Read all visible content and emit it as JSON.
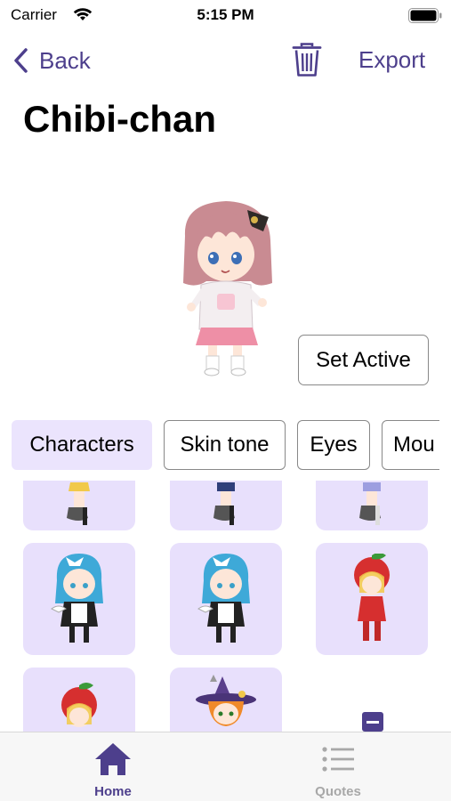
{
  "status_bar": {
    "carrier": "Carrier",
    "time": "5:15 PM"
  },
  "nav": {
    "back_label": "Back",
    "export_label": "Export"
  },
  "page": {
    "title": "Chibi-chan"
  },
  "actions": {
    "set_active_label": "Set Active"
  },
  "categories": {
    "items": [
      {
        "label": "Characters",
        "active": true
      },
      {
        "label": "Skin tone",
        "active": false
      },
      {
        "label": "Eyes",
        "active": false
      },
      {
        "label": "Mou",
        "active": false
      }
    ]
  },
  "tabbar": {
    "items": [
      {
        "label": "Home",
        "icon": "home-icon",
        "selected": true
      },
      {
        "label": "Quotes",
        "icon": "list-icon",
        "selected": false
      }
    ]
  },
  "colors": {
    "accent": "#4d3f8c",
    "tile_bg": "#e8e0fc",
    "tab_active_bg": "#ebe4fd",
    "tab_inactive": "#a8a8a8"
  }
}
